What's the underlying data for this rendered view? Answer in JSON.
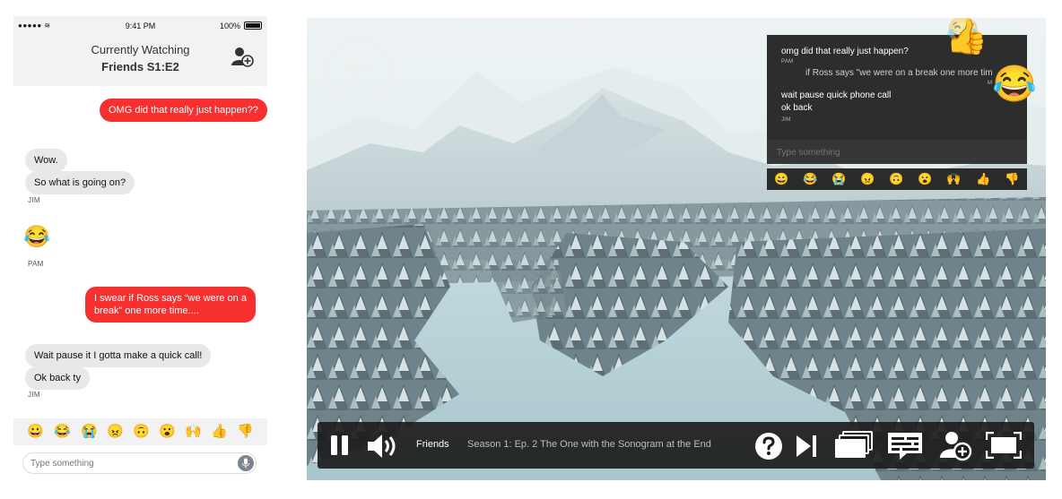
{
  "phone": {
    "status": {
      "signal": "●●●●● ≋",
      "time": "9:41 PM",
      "battery": "100%"
    },
    "header": {
      "line1": "Currently Watching",
      "line2": "Friends S1:E2"
    },
    "messages": {
      "m1": "OMG did that really just happen??",
      "m2": "Wow.",
      "m3": "So what is going on?",
      "m3_sender": "JIM",
      "m4_emoji": "😂",
      "m4_sender": "PAM",
      "m5_line1": "I swear if Ross says “we were on a",
      "m5_line2": "break” one more time....",
      "m6": "Wait pause it I gotta make a quick call!",
      "m7": "Ok back ty",
      "m7_sender": "JIM"
    },
    "emoji_bar": [
      "😀",
      "😂",
      "😭",
      "😠",
      "🙃",
      "😮",
      "🙌",
      "👍",
      "👎"
    ],
    "input_placeholder": "Type something"
  },
  "player": {
    "chat": {
      "msg1": "omg did that really just happen?",
      "msg1_sender": "PAM",
      "msg2": "if Ross says \"we were on a break one more tim",
      "msg2_sender": "M",
      "msg3": "wait pause quick phone call",
      "msg4": "ok back",
      "msg4_sender": "JIM",
      "input_placeholder": "Type something"
    },
    "emoji_bar": [
      "😀",
      "😂",
      "😭",
      "😠",
      "🙃",
      "😮",
      "🙌",
      "👍",
      "👎"
    ],
    "floating": {
      "thumbs": "👍",
      "laugh_faded": "😂",
      "laugh": "😂"
    },
    "controls": {
      "show_title": "Friends",
      "episode": "Season 1: Ep. 2 The One with the Sonogram at the End"
    }
  },
  "colors": {
    "my_bubble": "#f62f2f",
    "their_bubble": "#e8e8ea",
    "overlay": "#1c1c1c"
  }
}
